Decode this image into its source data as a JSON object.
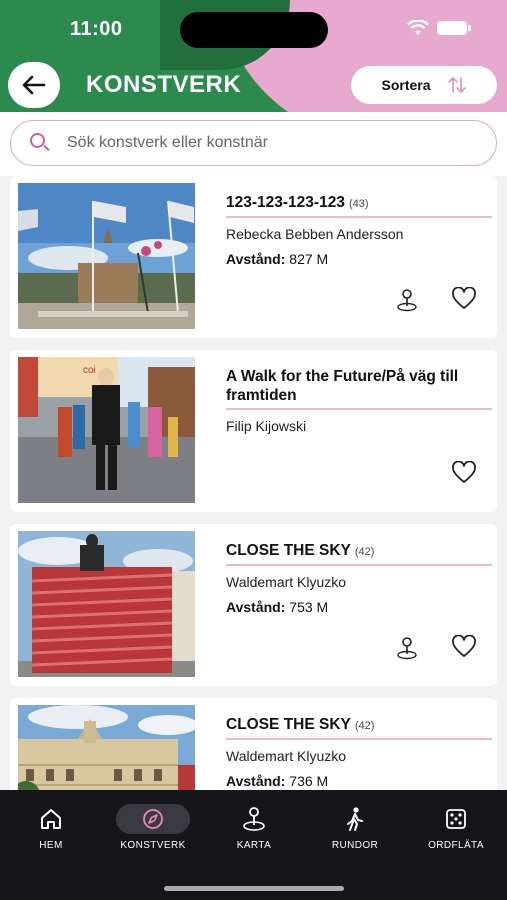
{
  "status_bar": {
    "time": "11:00"
  },
  "header": {
    "title": "KONSTVERK",
    "sort_label": "Sortera",
    "back_icon": "arrow-left-icon",
    "sort_icon": "sort-arrows-icon"
  },
  "search": {
    "placeholder": "Sök konstverk eller konstnär"
  },
  "artworks": [
    {
      "title": "123-123-123-123",
      "count": "(43)",
      "artist": "Rebecka Bebben Andersson",
      "distance_label": "Avstånd:",
      "distance_value": "827 M"
    },
    {
      "title": "A Walk for the Future/På väg till framtiden",
      "artist": "Filip Kijowski"
    },
    {
      "title": "CLOSE THE SKY",
      "count": "(42)",
      "artist": "Waldemart Klyuzko",
      "distance_label": "Avstånd:",
      "distance_value": "753 M"
    },
    {
      "title": "CLOSE THE SKY",
      "count": "(42)",
      "artist": "Waldemart Klyuzko",
      "distance_label": "Avstånd:",
      "distance_value": "736 M"
    }
  ],
  "tabs": [
    {
      "label": "HEM",
      "icon": "home-icon"
    },
    {
      "label": "KONSTVERK",
      "icon": "compass-icon",
      "active": true
    },
    {
      "label": "KARTA",
      "icon": "map-pin-icon"
    },
    {
      "label": "RUNDOR",
      "icon": "walking-icon"
    },
    {
      "label": "ORDFLÄTA",
      "icon": "dice-icon"
    }
  ],
  "colors": {
    "brand_green": "#2d8a4e",
    "brand_pink": "#e8a9cf",
    "accent_pink": "#d45d9c",
    "tabbar": "#16161a"
  }
}
